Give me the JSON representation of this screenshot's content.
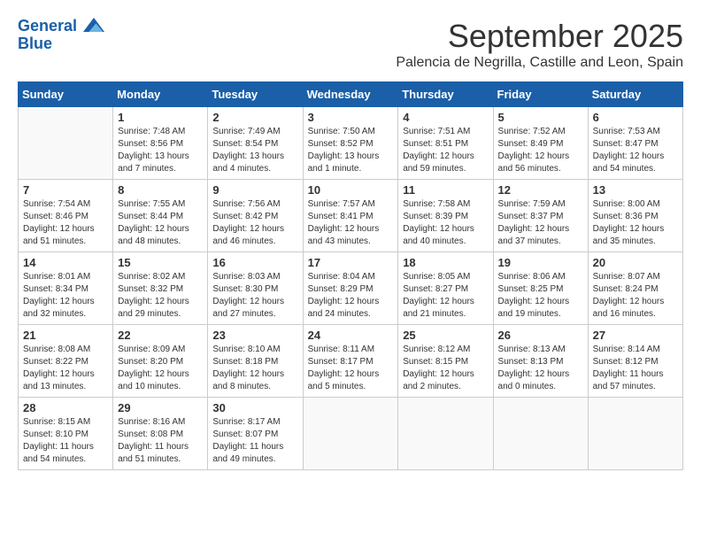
{
  "logo": {
    "line1": "General",
    "line2": "Blue"
  },
  "header": {
    "month_year": "September 2025",
    "location": "Palencia de Negrilla, Castille and Leon, Spain"
  },
  "weekdays": [
    "Sunday",
    "Monday",
    "Tuesday",
    "Wednesday",
    "Thursday",
    "Friday",
    "Saturday"
  ],
  "weeks": [
    [
      {
        "day": "",
        "sunrise": "",
        "sunset": "",
        "daylight": ""
      },
      {
        "day": "1",
        "sunrise": "Sunrise: 7:48 AM",
        "sunset": "Sunset: 8:56 PM",
        "daylight": "Daylight: 13 hours and 7 minutes."
      },
      {
        "day": "2",
        "sunrise": "Sunrise: 7:49 AM",
        "sunset": "Sunset: 8:54 PM",
        "daylight": "Daylight: 13 hours and 4 minutes."
      },
      {
        "day": "3",
        "sunrise": "Sunrise: 7:50 AM",
        "sunset": "Sunset: 8:52 PM",
        "daylight": "Daylight: 13 hours and 1 minute."
      },
      {
        "day": "4",
        "sunrise": "Sunrise: 7:51 AM",
        "sunset": "Sunset: 8:51 PM",
        "daylight": "Daylight: 12 hours and 59 minutes."
      },
      {
        "day": "5",
        "sunrise": "Sunrise: 7:52 AM",
        "sunset": "Sunset: 8:49 PM",
        "daylight": "Daylight: 12 hours and 56 minutes."
      },
      {
        "day": "6",
        "sunrise": "Sunrise: 7:53 AM",
        "sunset": "Sunset: 8:47 PM",
        "daylight": "Daylight: 12 hours and 54 minutes."
      }
    ],
    [
      {
        "day": "7",
        "sunrise": "Sunrise: 7:54 AM",
        "sunset": "Sunset: 8:46 PM",
        "daylight": "Daylight: 12 hours and 51 minutes."
      },
      {
        "day": "8",
        "sunrise": "Sunrise: 7:55 AM",
        "sunset": "Sunset: 8:44 PM",
        "daylight": "Daylight: 12 hours and 48 minutes."
      },
      {
        "day": "9",
        "sunrise": "Sunrise: 7:56 AM",
        "sunset": "Sunset: 8:42 PM",
        "daylight": "Daylight: 12 hours and 46 minutes."
      },
      {
        "day": "10",
        "sunrise": "Sunrise: 7:57 AM",
        "sunset": "Sunset: 8:41 PM",
        "daylight": "Daylight: 12 hours and 43 minutes."
      },
      {
        "day": "11",
        "sunrise": "Sunrise: 7:58 AM",
        "sunset": "Sunset: 8:39 PM",
        "daylight": "Daylight: 12 hours and 40 minutes."
      },
      {
        "day": "12",
        "sunrise": "Sunrise: 7:59 AM",
        "sunset": "Sunset: 8:37 PM",
        "daylight": "Daylight: 12 hours and 37 minutes."
      },
      {
        "day": "13",
        "sunrise": "Sunrise: 8:00 AM",
        "sunset": "Sunset: 8:36 PM",
        "daylight": "Daylight: 12 hours and 35 minutes."
      }
    ],
    [
      {
        "day": "14",
        "sunrise": "Sunrise: 8:01 AM",
        "sunset": "Sunset: 8:34 PM",
        "daylight": "Daylight: 12 hours and 32 minutes."
      },
      {
        "day": "15",
        "sunrise": "Sunrise: 8:02 AM",
        "sunset": "Sunset: 8:32 PM",
        "daylight": "Daylight: 12 hours and 29 minutes."
      },
      {
        "day": "16",
        "sunrise": "Sunrise: 8:03 AM",
        "sunset": "Sunset: 8:30 PM",
        "daylight": "Daylight: 12 hours and 27 minutes."
      },
      {
        "day": "17",
        "sunrise": "Sunrise: 8:04 AM",
        "sunset": "Sunset: 8:29 PM",
        "daylight": "Daylight: 12 hours and 24 minutes."
      },
      {
        "day": "18",
        "sunrise": "Sunrise: 8:05 AM",
        "sunset": "Sunset: 8:27 PM",
        "daylight": "Daylight: 12 hours and 21 minutes."
      },
      {
        "day": "19",
        "sunrise": "Sunrise: 8:06 AM",
        "sunset": "Sunset: 8:25 PM",
        "daylight": "Daylight: 12 hours and 19 minutes."
      },
      {
        "day": "20",
        "sunrise": "Sunrise: 8:07 AM",
        "sunset": "Sunset: 8:24 PM",
        "daylight": "Daylight: 12 hours and 16 minutes."
      }
    ],
    [
      {
        "day": "21",
        "sunrise": "Sunrise: 8:08 AM",
        "sunset": "Sunset: 8:22 PM",
        "daylight": "Daylight: 12 hours and 13 minutes."
      },
      {
        "day": "22",
        "sunrise": "Sunrise: 8:09 AM",
        "sunset": "Sunset: 8:20 PM",
        "daylight": "Daylight: 12 hours and 10 minutes."
      },
      {
        "day": "23",
        "sunrise": "Sunrise: 8:10 AM",
        "sunset": "Sunset: 8:18 PM",
        "daylight": "Daylight: 12 hours and 8 minutes."
      },
      {
        "day": "24",
        "sunrise": "Sunrise: 8:11 AM",
        "sunset": "Sunset: 8:17 PM",
        "daylight": "Daylight: 12 hours and 5 minutes."
      },
      {
        "day": "25",
        "sunrise": "Sunrise: 8:12 AM",
        "sunset": "Sunset: 8:15 PM",
        "daylight": "Daylight: 12 hours and 2 minutes."
      },
      {
        "day": "26",
        "sunrise": "Sunrise: 8:13 AM",
        "sunset": "Sunset: 8:13 PM",
        "daylight": "Daylight: 12 hours and 0 minutes."
      },
      {
        "day": "27",
        "sunrise": "Sunrise: 8:14 AM",
        "sunset": "Sunset: 8:12 PM",
        "daylight": "Daylight: 11 hours and 57 minutes."
      }
    ],
    [
      {
        "day": "28",
        "sunrise": "Sunrise: 8:15 AM",
        "sunset": "Sunset: 8:10 PM",
        "daylight": "Daylight: 11 hours and 54 minutes."
      },
      {
        "day": "29",
        "sunrise": "Sunrise: 8:16 AM",
        "sunset": "Sunset: 8:08 PM",
        "daylight": "Daylight: 11 hours and 51 minutes."
      },
      {
        "day": "30",
        "sunrise": "Sunrise: 8:17 AM",
        "sunset": "Sunset: 8:07 PM",
        "daylight": "Daylight: 11 hours and 49 minutes."
      },
      {
        "day": "",
        "sunrise": "",
        "sunset": "",
        "daylight": ""
      },
      {
        "day": "",
        "sunrise": "",
        "sunset": "",
        "daylight": ""
      },
      {
        "day": "",
        "sunrise": "",
        "sunset": "",
        "daylight": ""
      },
      {
        "day": "",
        "sunrise": "",
        "sunset": "",
        "daylight": ""
      }
    ]
  ]
}
